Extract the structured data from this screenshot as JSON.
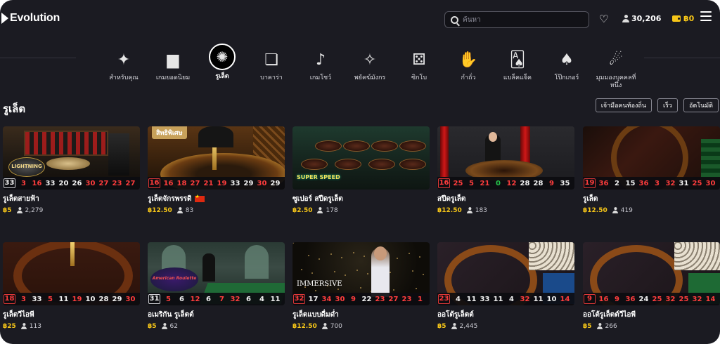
{
  "header": {
    "logo": "Evolution",
    "search_placeholder": "ค้นหา",
    "players": "30,206",
    "balance": "฿0"
  },
  "nav": [
    {
      "label": "สำหรับคุณ",
      "icon": "sparkles-icon",
      "glyph": "✦"
    },
    {
      "label": "เกมยอดนิยม",
      "icon": "podium-icon",
      "glyph": "▆"
    },
    {
      "label": "รูเล็ต",
      "icon": "roulette-wheel-icon",
      "glyph": "✺",
      "active": true
    },
    {
      "label": "บาคาร่า",
      "icon": "baccarat-chat-icon",
      "glyph": "❏"
    },
    {
      "label": "เกมโชว์",
      "icon": "microphone-icon",
      "glyph": "♪"
    },
    {
      "label": "พยัคฆ์มังกร",
      "icon": "dragon-tiger-icon",
      "glyph": "✧"
    },
    {
      "label": "ซิกโบ",
      "icon": "dice-icon",
      "glyph": "⚄"
    },
    {
      "label": "กำถั่ว",
      "icon": "fan-tan-hand-icon",
      "glyph": "✋"
    },
    {
      "label": "แบล็คแจ็ค",
      "icon": "cards-icon",
      "glyph": "🂡"
    },
    {
      "label": "โป๊กเกอร์",
      "icon": "poker-cards-icon",
      "glyph": "♠"
    },
    {
      "label": "มุมมองบุคคลที่หนึ่ง",
      "icon": "first-person-icon",
      "glyph": "☄"
    }
  ],
  "section": {
    "title": "รูเล็ต",
    "filters": [
      "เจ้ามือคนท้องถิ่น",
      "เร็ว",
      "อัตโนมัติ"
    ]
  },
  "games": [
    {
      "name": "รูเล็ตสายฟ้า",
      "bet": "฿5",
      "players": "2,279",
      "badge": "",
      "flag": false,
      "results": [
        [
          "33",
          "b"
        ],
        [
          "3",
          "r"
        ],
        [
          "16",
          "r"
        ],
        [
          "33",
          "b"
        ],
        [
          "20",
          "b"
        ],
        [
          "26",
          "b"
        ],
        [
          "30",
          "r"
        ],
        [
          "27",
          "r"
        ],
        [
          "23",
          "r"
        ],
        [
          "27",
          "r"
        ]
      ]
    },
    {
      "name": "รูเล็ตจักรพรรดิ",
      "bet": "฿12.50",
      "players": "83",
      "badge": "สิทธิพิเศษ",
      "flag": true,
      "results": [
        [
          "16",
          "r"
        ],
        [
          "16",
          "r"
        ],
        [
          "18",
          "r"
        ],
        [
          "27",
          "r"
        ],
        [
          "21",
          "r"
        ],
        [
          "19",
          "r"
        ],
        [
          "33",
          "b"
        ],
        [
          "29",
          "b"
        ],
        [
          "30",
          "r"
        ],
        [
          "29",
          "b"
        ]
      ]
    },
    {
      "name": "ซูเปอร์ สปีดรูเล็ต",
      "bet": "฿2.50",
      "players": "178",
      "badge": "",
      "flag": false,
      "results": []
    },
    {
      "name": "สปีดรูเล็ต",
      "bet": "฿12.50",
      "players": "183",
      "badge": "",
      "flag": false,
      "results": [
        [
          "16",
          "r"
        ],
        [
          "25",
          "r"
        ],
        [
          "5",
          "r"
        ],
        [
          "21",
          "r"
        ],
        [
          "0",
          "g"
        ],
        [
          "12",
          "r"
        ],
        [
          "28",
          "b"
        ],
        [
          "28",
          "b"
        ],
        [
          "9",
          "r"
        ],
        [
          "35",
          "b"
        ]
      ]
    },
    {
      "name": "รูเล็ต",
      "bet": "฿12.50",
      "players": "419",
      "badge": "",
      "flag": false,
      "results": [
        [
          "19",
          "r"
        ],
        [
          "36",
          "r"
        ],
        [
          "2",
          "b"
        ],
        [
          "15",
          "b"
        ],
        [
          "36",
          "r"
        ],
        [
          "3",
          "r"
        ],
        [
          "32",
          "r"
        ],
        [
          "31",
          "b"
        ],
        [
          "25",
          "r"
        ],
        [
          "30",
          "r"
        ]
      ]
    },
    {
      "name": "รูเล็ตวีไอพี",
      "bet": "฿25",
      "players": "113",
      "badge": "",
      "flag": false,
      "results": [
        [
          "18",
          "r"
        ],
        [
          "3",
          "r"
        ],
        [
          "33",
          "b"
        ],
        [
          "5",
          "r"
        ],
        [
          "11",
          "b"
        ],
        [
          "19",
          "r"
        ],
        [
          "10",
          "b"
        ],
        [
          "28",
          "b"
        ],
        [
          "29",
          "b"
        ],
        [
          "30",
          "r"
        ]
      ]
    },
    {
      "name": "อเมริกัน รูเล็ตต์",
      "bet": "฿5",
      "players": "62",
      "badge": "",
      "flag": false,
      "results": [
        [
          "31",
          "b"
        ],
        [
          "5",
          "r"
        ],
        [
          "6",
          "b"
        ],
        [
          "12",
          "r"
        ],
        [
          "6",
          "b"
        ],
        [
          "7",
          "r"
        ],
        [
          "32",
          "r"
        ],
        [
          "6",
          "b"
        ],
        [
          "4",
          "b"
        ],
        [
          "11",
          "b"
        ]
      ]
    },
    {
      "name": "รูเล็ตแบบดื่มด่ำ",
      "bet": "฿12.50",
      "players": "700",
      "badge": "",
      "flag": false,
      "results": [
        [
          "32",
          "r"
        ],
        [
          "17",
          "b"
        ],
        [
          "34",
          "r"
        ],
        [
          "30",
          "r"
        ],
        [
          "9",
          "r"
        ],
        [
          "22",
          "b"
        ],
        [
          "23",
          "r"
        ],
        [
          "27",
          "r"
        ],
        [
          "23",
          "r"
        ],
        [
          "1",
          "r"
        ]
      ]
    },
    {
      "name": "ออโต้รูเล็ตต์",
      "bet": "฿5",
      "players": "2,445",
      "badge": "",
      "flag": false,
      "results": [
        [
          "23",
          "r"
        ],
        [
          "4",
          "b"
        ],
        [
          "11",
          "b"
        ],
        [
          "33",
          "b"
        ],
        [
          "11",
          "b"
        ],
        [
          "4",
          "b"
        ],
        [
          "32",
          "r"
        ],
        [
          "11",
          "b"
        ],
        [
          "10",
          "b"
        ],
        [
          "14",
          "r"
        ]
      ]
    },
    {
      "name": "ออโต้รูเล็ตต์วีไอพี",
      "bet": "฿5",
      "players": "266",
      "badge": "",
      "flag": false,
      "results": [
        [
          "9",
          "r"
        ],
        [
          "16",
          "r"
        ],
        [
          "9",
          "r"
        ],
        [
          "36",
          "r"
        ],
        [
          "24",
          "b"
        ],
        [
          "25",
          "r"
        ],
        [
          "32",
          "r"
        ],
        [
          "25",
          "r"
        ],
        [
          "32",
          "r"
        ],
        [
          "14",
          "r"
        ]
      ]
    }
  ],
  "art": {
    "lightning": "LIGHTNING",
    "superspeed": "SUPER SPEED",
    "american": "American Roulette",
    "immersive": "IMMERSIVE"
  }
}
